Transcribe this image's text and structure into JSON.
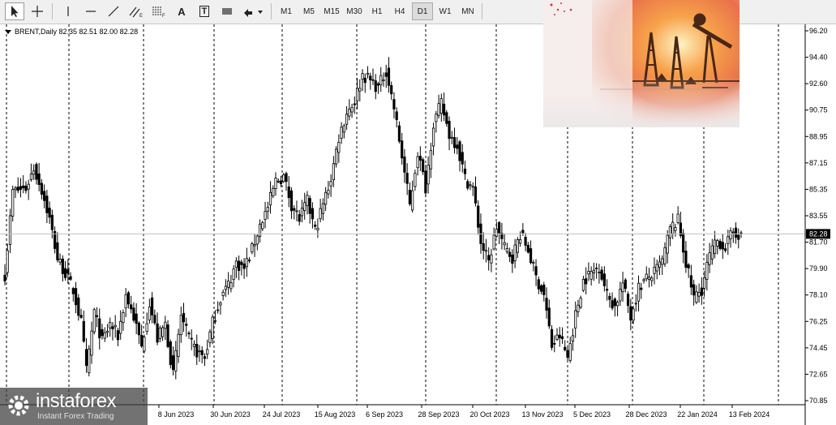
{
  "toolbar": {
    "tools": [
      {
        "name": "cursor-icon",
        "active": true
      },
      {
        "name": "crosshair-icon"
      },
      {
        "name": "vertical-line-icon"
      },
      {
        "name": "horizontal-line-icon"
      },
      {
        "name": "trendline-icon"
      },
      {
        "name": "equidistant-channel-icon"
      },
      {
        "name": "fibonacci-icon"
      },
      {
        "name": "text-icon",
        "label": "A"
      },
      {
        "name": "text-label-icon",
        "label": "T"
      },
      {
        "name": "shapes-icon"
      },
      {
        "name": "arrows-menu-icon"
      }
    ],
    "timeframes": [
      "M1",
      "M5",
      "M15",
      "M30",
      "H1",
      "H4",
      "D1",
      "W1",
      "MN"
    ],
    "active_timeframe": "D1"
  },
  "symbol_label": "BRENT,Daily  82.35 82.51 82.00 82.28",
  "watermark": {
    "brand": "instaforex",
    "tagline": "Instant Forex Trading"
  },
  "colors": {
    "candle": "#000000",
    "grid": "#000000",
    "price_line": "#c0c0c0",
    "price_tag_bg": "#000000",
    "price_tag_text": "#ffffff"
  },
  "chart_data": {
    "type": "candlestick",
    "symbol": "BRENT",
    "timeframe": "Daily",
    "last_ohlc": {
      "open": 82.35,
      "high": 82.51,
      "low": 82.0,
      "close": 82.28
    },
    "current_price": 82.28,
    "current_price_label": "82.28",
    "ylim": [
      70.85,
      96.2
    ],
    "y_ticks": [
      "96.20",
      "94.40",
      "92.60",
      "90.75",
      "88.95",
      "87.15",
      "85.35",
      "83.55",
      "81.70",
      "79.90",
      "78.10",
      "76.25",
      "74.45",
      "72.65",
      "70.85"
    ],
    "x_ticks": [
      "8 Jun 2023",
      "30 Jun 2023",
      "24 Jul 2023",
      "15 Aug 2023",
      "6 Sep 2023",
      "28 Sep 2023",
      "20 Oct 2023",
      "13 Nov 2023",
      "5 Dec 2023",
      "28 Dec 2023",
      "22 Jan 2024",
      "13 Feb 2024"
    ],
    "grid": "vertical dashed",
    "close_path": [
      [
        0,
        79.5
      ],
      [
        3,
        85.2
      ],
      [
        8,
        85.4
      ],
      [
        11,
        86.8
      ],
      [
        14,
        85.3
      ],
      [
        17,
        83.3
      ],
      [
        20,
        80.6
      ],
      [
        23,
        79.6
      ],
      [
        26,
        78.4
      ],
      [
        29,
        76.2
      ],
      [
        31,
        72.9
      ],
      [
        34,
        76.9
      ],
      [
        37,
        74.9
      ],
      [
        40,
        76.1
      ],
      [
        43,
        75.3
      ],
      [
        46,
        78.1
      ],
      [
        49,
        76.6
      ],
      [
        52,
        74.5
      ],
      [
        55,
        77.6
      ],
      [
        58,
        75.1
      ],
      [
        61,
        76.1
      ],
      [
        64,
        72.6
      ],
      [
        67,
        76.7
      ],
      [
        70,
        75.0
      ],
      [
        73,
        74.2
      ],
      [
        76,
        73.8
      ],
      [
        79,
        76.2
      ],
      [
        82,
        77.9
      ],
      [
        85,
        78.8
      ],
      [
        88,
        80.3
      ],
      [
        91,
        79.9
      ],
      [
        94,
        81.2
      ],
      [
        97,
        82.9
      ],
      [
        100,
        84.1
      ],
      [
        103,
        85.9
      ],
      [
        106,
        86.2
      ],
      [
        109,
        84.3
      ],
      [
        112,
        83.3
      ],
      [
        115,
        84.5
      ],
      [
        118,
        82.5
      ],
      [
        121,
        84.3
      ],
      [
        124,
        86.1
      ],
      [
        127,
        88.9
      ],
      [
        130,
        90.6
      ],
      [
        133,
        91.4
      ],
      [
        136,
        93.2
      ],
      [
        139,
        92.8
      ],
      [
        142,
        92.3
      ],
      [
        145,
        93.5
      ],
      [
        148,
        90.9
      ],
      [
        151,
        87.6
      ],
      [
        154,
        84.2
      ],
      [
        157,
        87.9
      ],
      [
        160,
        85.5
      ],
      [
        163,
        89.9
      ],
      [
        166,
        91.2
      ],
      [
        169,
        89.1
      ],
      [
        172,
        88.4
      ],
      [
        175,
        86.1
      ],
      [
        178,
        85.4
      ],
      [
        181,
        81.7
      ],
      [
        184,
        80.3
      ],
      [
        187,
        82.8
      ],
      [
        190,
        81.3
      ],
      [
        193,
        80.7
      ],
      [
        196,
        82.3
      ],
      [
        199,
        81.2
      ],
      [
        202,
        79.3
      ],
      [
        205,
        78.1
      ],
      [
        208,
        74.6
      ],
      [
        211,
        75.3
      ],
      [
        214,
        73.8
      ],
      [
        217,
        76.7
      ],
      [
        220,
        79.1
      ],
      [
        223,
        79.6
      ],
      [
        226,
        80.1
      ],
      [
        229,
        78.1
      ],
      [
        232,
        77.3
      ],
      [
        235,
        78.9
      ],
      [
        238,
        76.6
      ],
      [
        241,
        78.6
      ],
      [
        244,
        79.2
      ],
      [
        247,
        79.6
      ],
      [
        250,
        80.4
      ],
      [
        253,
        82.6
      ],
      [
        256,
        83.2
      ],
      [
        259,
        80.3
      ],
      [
        262,
        77.9
      ],
      [
        265,
        78.5
      ],
      [
        268,
        80.8
      ],
      [
        271,
        81.8
      ],
      [
        274,
        81.4
      ],
      [
        277,
        82.4
      ],
      [
        280,
        82.28
      ]
    ]
  }
}
